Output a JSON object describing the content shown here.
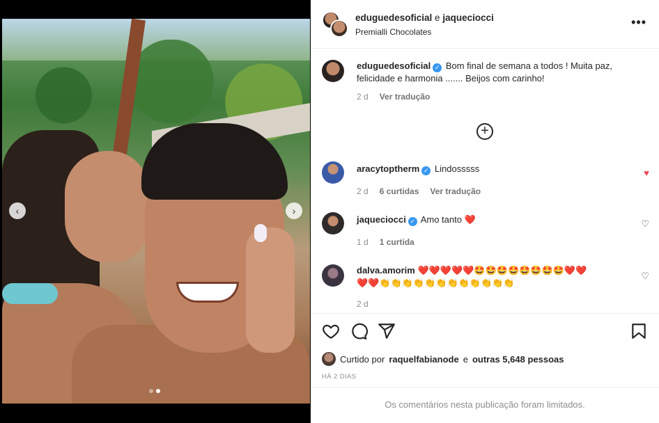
{
  "header": {
    "user1": "eduguedesoficial",
    "conjunction": "e",
    "user2": "jaqueciocci",
    "location": "Premialli Chocolates",
    "more_icon": "more-horizontal-icon"
  },
  "caption": {
    "username": "eduguedesoficial",
    "text": "Bom final de semana a todos ! Muita paz, felicidade e harmonia ....... Beijos com carinho!",
    "age": "2 d",
    "translate": "Ver tradução"
  },
  "load_more_icon": "plus-circle-icon",
  "comments": [
    {
      "username": "aracytoptherm",
      "verified": true,
      "text": "Lindosssss",
      "age": "2 d",
      "likes": "6 curtidas",
      "translate": "Ver tradução",
      "liked": true
    },
    {
      "username": "jaqueciocci",
      "verified": true,
      "text": "Amo tanto ❤️",
      "age": "1 d",
      "likes": "1 curtida",
      "liked": false
    },
    {
      "username": "dalva.amorim",
      "verified": false,
      "text": "❤️❤️❤️❤️❤️🤩🤩🤩🤩🤩🤩🤩🤩❤️❤️",
      "text2": "❤️❤️👏👏👏👏👏👏👏👏👏👏👏👏",
      "age": "2 d",
      "liked": false
    }
  ],
  "actions": {
    "like_icon": "heart-outline-icon",
    "comment_icon": "comment-bubble-icon",
    "share_icon": "paper-plane-icon",
    "save_icon": "bookmark-icon"
  },
  "likes": {
    "prefix": "Curtido por",
    "user": "raquelfabianode",
    "conjunction": "e",
    "others": "outras 5,648 pessoas"
  },
  "timestamp": "HÁ 2 DIAS",
  "comments_limited": "Os comentários nesta publicação foram limitados.",
  "carousel": {
    "slides": 2,
    "active_slide": 2
  },
  "colors": {
    "verified": "#3897f0",
    "liked_heart": "#ed4956",
    "muted": "#8e8e8e"
  }
}
